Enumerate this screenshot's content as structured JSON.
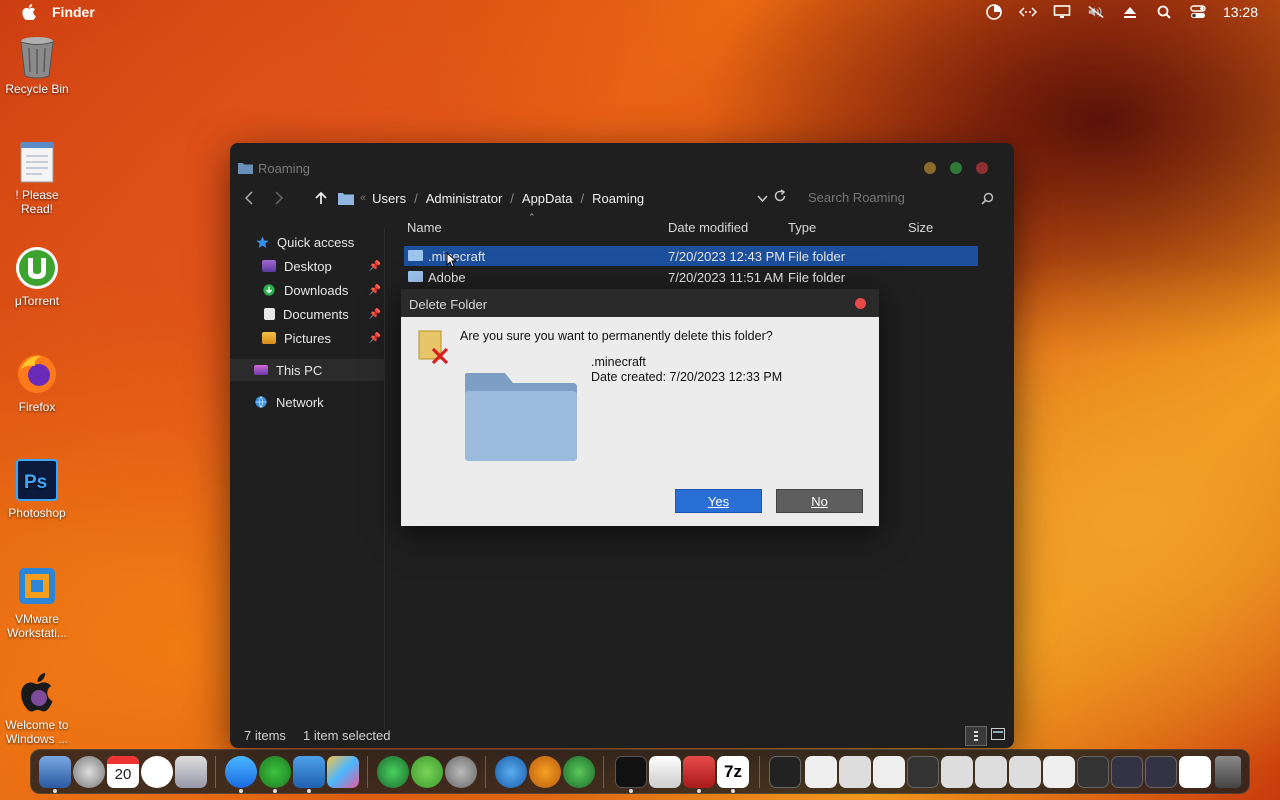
{
  "menubar": {
    "app_name": "Finder",
    "clock": "13:28",
    "icons": [
      "apple-icon",
      "gauge-icon",
      "code-icon",
      "display-icon",
      "mute-icon",
      "eject-icon",
      "search-icon",
      "control-center-icon"
    ]
  },
  "desktop": {
    "icons": [
      {
        "label": "Recycle Bin",
        "icon": "recycle-bin-icon"
      },
      {
        "label": "! Please Read!",
        "icon": "notepad-icon"
      },
      {
        "label": "μTorrent",
        "icon": "utorrent-icon"
      },
      {
        "label": "Firefox",
        "icon": "firefox-icon"
      },
      {
        "label": "Photoshop",
        "icon": "photoshop-icon"
      },
      {
        "label": "VMware Workstati...",
        "icon": "vmware-icon"
      },
      {
        "label": "Welcome to Windows ...",
        "icon": "apple-logo-icon"
      }
    ]
  },
  "explorer": {
    "title": "Roaming",
    "breadcrumb": [
      "Users",
      "Administrator",
      "AppData",
      "Roaming"
    ],
    "search_placeholder": "Search Roaming",
    "sidebar": [
      {
        "label": "Quick access",
        "icon": "star-icon",
        "pinned": false
      },
      {
        "label": "Desktop",
        "icon": "desktop-folder-icon",
        "pinned": true
      },
      {
        "label": "Downloads",
        "icon": "downloads-icon",
        "pinned": true
      },
      {
        "label": "Documents",
        "icon": "documents-icon",
        "pinned": true
      },
      {
        "label": "Pictures",
        "icon": "pictures-icon",
        "pinned": true
      },
      {
        "label": "This PC",
        "icon": "pc-icon",
        "pinned": false
      },
      {
        "label": "Network",
        "icon": "network-icon",
        "pinned": false
      }
    ],
    "columns": {
      "name": "Name",
      "date": "Date modified",
      "type": "Type",
      "size": "Size"
    },
    "rows": [
      {
        "name": ".minecraft",
        "date": "7/20/2023 12:43 PM",
        "type": "File folder",
        "selected": true
      },
      {
        "name": "Adobe",
        "date": "7/20/2023 11:51 AM",
        "type": "File folder",
        "selected": false
      }
    ],
    "status": {
      "items": "7 items",
      "selected": "1 item selected"
    }
  },
  "dialog": {
    "title": "Delete Folder",
    "question": "Are you sure you want to permanently delete this folder?",
    "folder_name": ".minecraft",
    "date_created": "Date created: 7/20/2023 12:33 PM",
    "yes_label": "Yes",
    "no_label": "No"
  },
  "colors": {
    "accent": "#1c4f9c",
    "yes_button": "#2a6fd6",
    "close_red": "#e84a4a"
  }
}
